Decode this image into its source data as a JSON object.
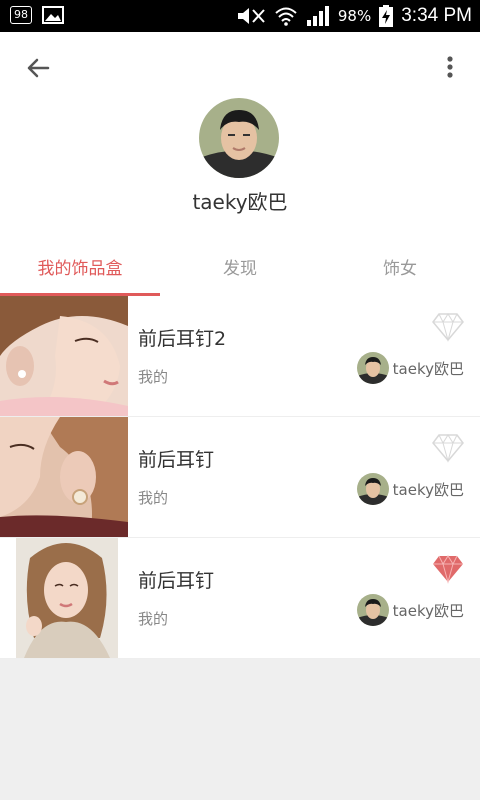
{
  "status_bar": {
    "notification_count": "98",
    "battery": "98%",
    "time": "3:34 PM",
    "icons": [
      "image-icon",
      "mute-icon",
      "wifi-icon",
      "signal-icon",
      "battery-charging-icon"
    ]
  },
  "header": {
    "back_icon": "arrow-left-icon",
    "menu_icon": "more-vert-icon",
    "username": "taeky欧巴"
  },
  "tabs": [
    {
      "label": "我的饰品盒",
      "active": true
    },
    {
      "label": "发现",
      "active": false
    },
    {
      "label": "饰女",
      "active": false
    }
  ],
  "items": [
    {
      "title": "前后耳钉2",
      "subtitle": "我的",
      "owner": "taeky欧巴",
      "liked": false
    },
    {
      "title": "前后耳钉",
      "subtitle": "我的",
      "owner": "taeky欧巴",
      "liked": false
    },
    {
      "title": "前后耳钉",
      "subtitle": "我的",
      "owner": "taeky欧巴",
      "liked": true
    }
  ],
  "colors": {
    "accent": "#e05a5a",
    "gem_inactive": "#d8d8d8",
    "gem_active": "#e06a6a"
  }
}
